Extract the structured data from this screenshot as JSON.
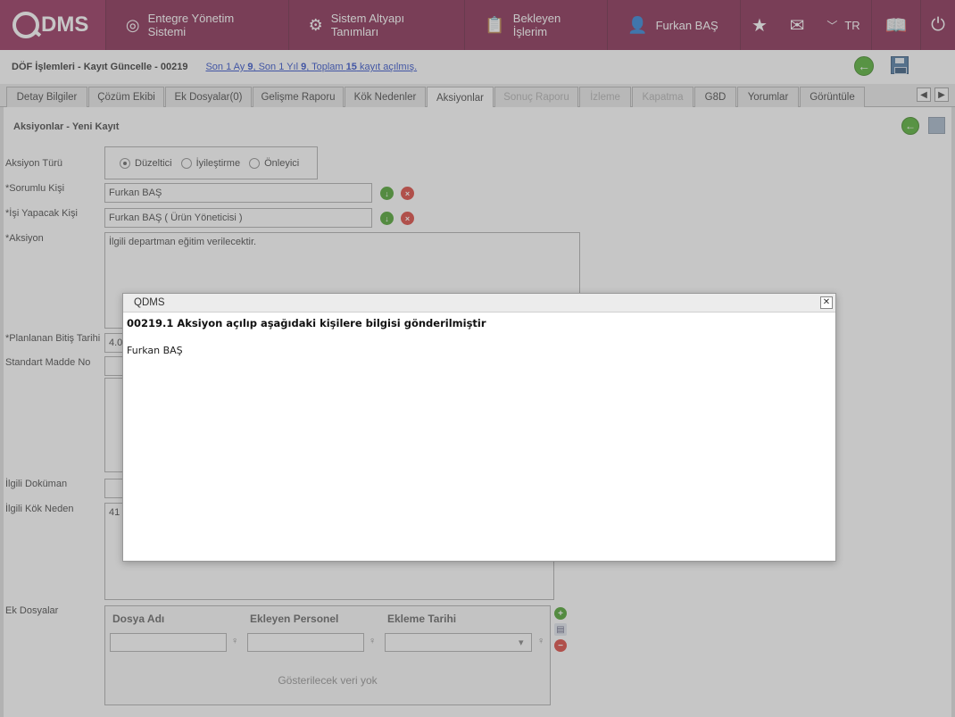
{
  "topbar": {
    "logo": "DMS",
    "nav": [
      {
        "label": "Entegre Yönetim Sistemi",
        "icon": "qdms-icon"
      },
      {
        "label": "Sistem Altyapı Tanımları",
        "icon": "gear-icon"
      },
      {
        "label": "Bekleyen İşlerim",
        "icon": "clipboard-icon"
      },
      {
        "label": "Furkan BAŞ",
        "icon": "user-icon"
      }
    ],
    "lang": "TR"
  },
  "titlebar": {
    "title": "DÖF İşlemleri - Kayıt Güncelle - 00219",
    "sub_prefix": "Son 1 Ay ",
    "sub_month": "9",
    "sub_mid": ", Son 1 Yıl ",
    "sub_year": "9",
    "sub_mid2": ", Toplam ",
    "sub_total": "15",
    "sub_suffix": " kayıt açılmış."
  },
  "tabs": [
    {
      "label": "Detay Bilgiler"
    },
    {
      "label": "Çözüm Ekibi"
    },
    {
      "label": "Ek Dosyalar(0)"
    },
    {
      "label": "Gelişme Raporu"
    },
    {
      "label": "Kök Nedenler"
    },
    {
      "label": "Aksiyonlar"
    },
    {
      "label": "Sonuç Raporu"
    },
    {
      "label": "İzleme"
    },
    {
      "label": "Kapatma"
    },
    {
      "label": "G8D"
    },
    {
      "label": "Yorumlar"
    },
    {
      "label": "Görüntüle"
    }
  ],
  "form": {
    "section_title": "Aksiyonlar - Yeni Kayıt",
    "aksiyon_turu_label": "Aksiyon Türü",
    "radio_options": [
      "Düzeltici",
      "İyileştirme",
      "Önleyici"
    ],
    "sorumlu_label": "*Sorumlu Kişi",
    "sorumlu_value": "Furkan BAŞ",
    "isi_yapacak_label": "*İşi Yapacak Kişi",
    "isi_yapacak_value": "Furkan BAŞ ( Ürün Yöneticisi )",
    "aksiyon_label": "*Aksiyon",
    "aksiyon_value": "İlgili departman eğitim verilecektir.",
    "plan_label": "*Planlanan Bitiş Tarihi",
    "plan_value": "4.0",
    "standart_label": "Standart Madde No",
    "ilgili_dok_label": "İlgili Doküman",
    "kok_neden_label": "İlgili Kök Neden",
    "kok_neden_value": "41",
    "ek_dosyalar_label": "Ek Dosyalar",
    "grid_headers": [
      "Dosya Adı",
      "Ekleyen Personel",
      "Ekleme Tarihi"
    ],
    "grid_empty": "Gösterilecek veri yok"
  },
  "dialog": {
    "title": "QDMS",
    "message": "00219.1 Aksiyon açılıp aşağıdaki kişilere bilgisi gönderilmiştir",
    "recipient": "Furkan BAŞ"
  }
}
